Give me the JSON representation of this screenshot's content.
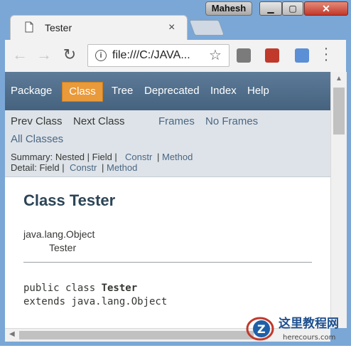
{
  "window": {
    "user_badge": "Mahesh"
  },
  "tab": {
    "title": "Tester",
    "close_glyph": "×"
  },
  "toolbar": {
    "back_glyph": "←",
    "forward_glyph": "→",
    "reload_glyph": "↻",
    "url": "file:///C:/JAVA...",
    "star_glyph": "☆"
  },
  "javadoc": {
    "top_nav": [
      "Package",
      "Class",
      "Tree",
      "Deprecated",
      "Index",
      "Help"
    ],
    "active_nav": "Class",
    "prev_class": "Prev Class",
    "next_class": "Next Class",
    "frames": "Frames",
    "no_frames": "No Frames",
    "all_classes": "All Classes",
    "summary_label": "Summary: Nested | Field |",
    "summary_constr": "Constr",
    "summary_sep": "|",
    "summary_method": "Method",
    "detail_label": "Detail: Field |",
    "detail_constr": "Constr",
    "detail_sep": "|",
    "detail_method": "Method",
    "title": "Class Tester",
    "inheritance": [
      "java.lang.Object",
      "Tester"
    ],
    "decl_line1_prefix": "public class ",
    "decl_line1_name": "Tester",
    "decl_line2": "extends java.lang.Object"
  },
  "watermark": {
    "name": "这里教程网",
    "url": "herecours.com",
    "letter": "Z"
  },
  "colors": {
    "nav_bg": "#4f6f8f",
    "nav_active": "#e99a3a",
    "subnav_bg": "#dee3e9",
    "title_color": "#2c4557"
  }
}
